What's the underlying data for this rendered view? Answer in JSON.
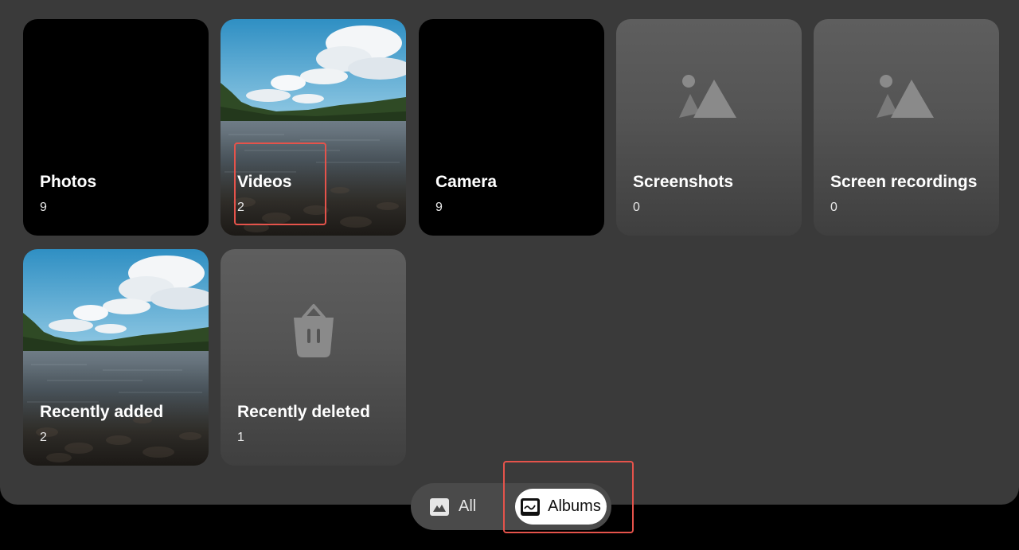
{
  "albums": [
    {
      "name": "Photos",
      "count": "9"
    },
    {
      "name": "Videos",
      "count": "2"
    },
    {
      "name": "Camera",
      "count": "9"
    },
    {
      "name": "Screenshots",
      "count": "0"
    },
    {
      "name": "Screen recordings",
      "count": "0"
    },
    {
      "name": "Recently added",
      "count": "2"
    },
    {
      "name": "Recently deleted",
      "count": "1"
    }
  ],
  "tabs": {
    "all_label": "All",
    "albums_label": "Albums",
    "selected": "Albums"
  },
  "icons": {
    "all_tab": "landscape-image-icon",
    "albums_tab": "album-image-icon",
    "screenshots_placeholder": "image-placeholder-icon",
    "recordings_placeholder": "image-placeholder-icon",
    "deleted_placeholder": "trash-icon"
  },
  "colors": {
    "background": "#000000",
    "panel": "#3a3a3a",
    "tile_placeholder": "#545454",
    "highlight": "#e5534b",
    "selected_tab": "#ffffff"
  }
}
